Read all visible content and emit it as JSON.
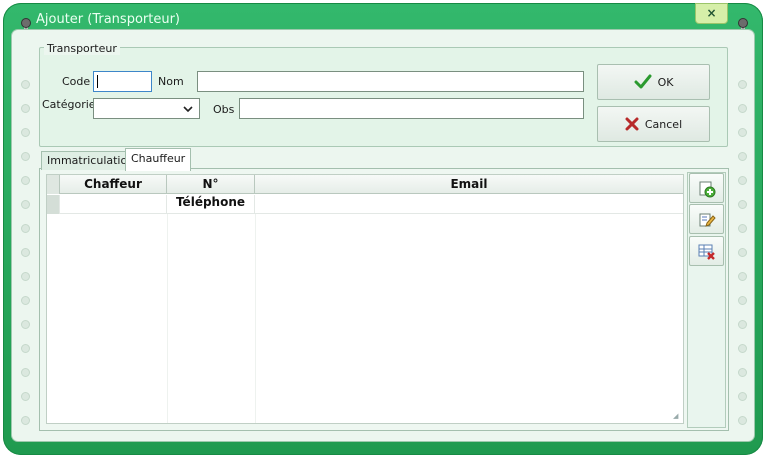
{
  "window": {
    "title": "Ajouter (Transporteur)",
    "close_glyph": "×"
  },
  "transporteur": {
    "legend": "Transporteur",
    "code_label": "Code",
    "code_value": "",
    "nom_label": "Nom",
    "nom_value": "",
    "categorie_label": "Catégorie",
    "categorie_value": "",
    "obs_label": "Obs",
    "obs_value": ""
  },
  "buttons": {
    "ok_label": "OK",
    "cancel_label": "Cancel"
  },
  "tabs": [
    {
      "label": "Immatriculation",
      "active": false
    },
    {
      "label": "Chauffeur",
      "active": true
    }
  ],
  "grid": {
    "columns": [
      "Chaffeur",
      "N° Téléphone",
      "Email"
    ],
    "rows": [
      [
        "",
        "",
        ""
      ]
    ]
  },
  "toolbar": {
    "icons": [
      "add-record-icon",
      "edit-record-icon",
      "delete-record-icon"
    ]
  },
  "colors": {
    "frame": "#2aac5e",
    "panel": "#ecf6ef",
    "ok": "#2b9a2f",
    "cancel": "#b72a2a"
  }
}
